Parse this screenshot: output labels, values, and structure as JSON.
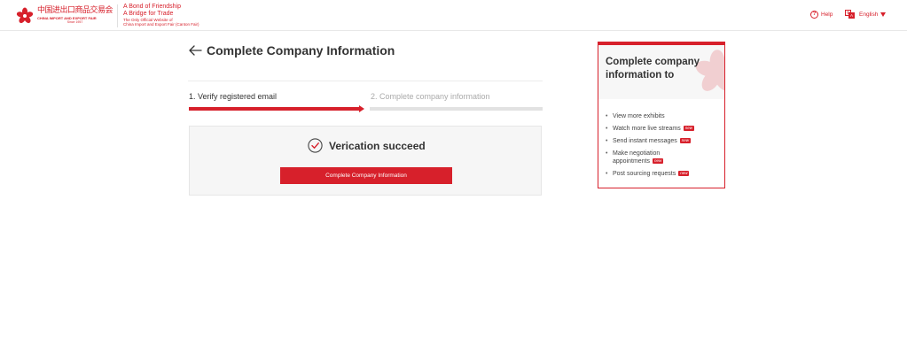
{
  "header": {
    "logo": {
      "cn_text": "中国进出口商品交易会",
      "en_text": "CHINA IMPORT AND EXPORT FAIR",
      "since": "Since 1957"
    },
    "slogan": {
      "line1": "A Bond of Friendship",
      "line2": "A Bridge for Trade",
      "line3": "The Only Official Website of",
      "line4": "China Import and Export Fair (Canton Fair)"
    },
    "help_label": "Help",
    "language_label": "English",
    "colors": {
      "brand": "#d7202b"
    }
  },
  "main": {
    "title": "Complete Company Information",
    "steps": [
      {
        "label": "1. Verify registered email",
        "state": "done"
      },
      {
        "label": "2. Complete company information",
        "state": "pending"
      }
    ],
    "result": {
      "message": "Verication succeed",
      "button_label": "Complete Company Information"
    }
  },
  "sidebar_card": {
    "title": "Complete company information to",
    "badge_label": "new",
    "items": [
      {
        "label": "View more exhibits",
        "badge": ""
      },
      {
        "label": "Watch more live streams",
        "badge": "new"
      },
      {
        "label": "Send instant messages",
        "badge": "new"
      },
      {
        "label": "Make negotiation",
        "label2": "appointments",
        "badge": "new"
      },
      {
        "label": "Post sourcing requests",
        "badge": "new"
      }
    ]
  }
}
